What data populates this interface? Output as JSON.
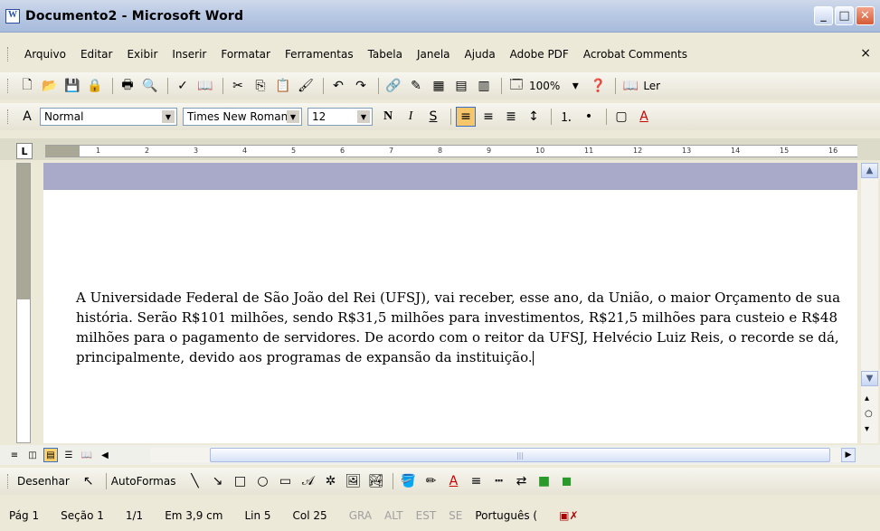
{
  "window": {
    "title": "Documento2 - Microsoft Word"
  },
  "menu": {
    "items": [
      "Arquivo",
      "Editar",
      "Exibir",
      "Inserir",
      "Formatar",
      "Ferramentas",
      "Tabela",
      "Janela",
      "Ajuda",
      "Adobe PDF",
      "Acrobat Comments"
    ],
    "close": "×"
  },
  "toolbar": {
    "zoom": "100%",
    "read_label": "Ler"
  },
  "formatting": {
    "style": "Normal",
    "font": "Times New Roman",
    "size": "12",
    "bold": "N",
    "italic": "I",
    "underline": "S"
  },
  "ruler": {
    "numbers": [
      "1",
      "2",
      "3",
      "4",
      "5",
      "6",
      "7",
      "8",
      "9",
      "10",
      "11",
      "12",
      "13",
      "14",
      "15",
      "16"
    ]
  },
  "document": {
    "text": "A Universidade Federal de São João del Rei (UFSJ), vai receber, esse ano, da União, o maior Orçamento de sua história. Serão R$101 milhões, sendo R$31,5 milhões para investimentos, R$21,5 milhões para custeio e R$48 milhões para o pagamento de servidores. De acordo com o reitor da UFSJ, Helvécio Luiz Reis, o recorde se dá, principalmente, devido aos programas de expansão da instituição."
  },
  "drawing": {
    "draw_label": "Desenhar",
    "autoshapes_label": "AutoFormas"
  },
  "status": {
    "page": "Pág 1",
    "section": "Seção 1",
    "pages": "1/1",
    "position": "Em 3,9 cm",
    "line": "Lin 5",
    "column": "Col 25",
    "rec": "GRA",
    "track": "ALT",
    "ext": "EST",
    "ovr": "SE",
    "language": "Português ("
  }
}
